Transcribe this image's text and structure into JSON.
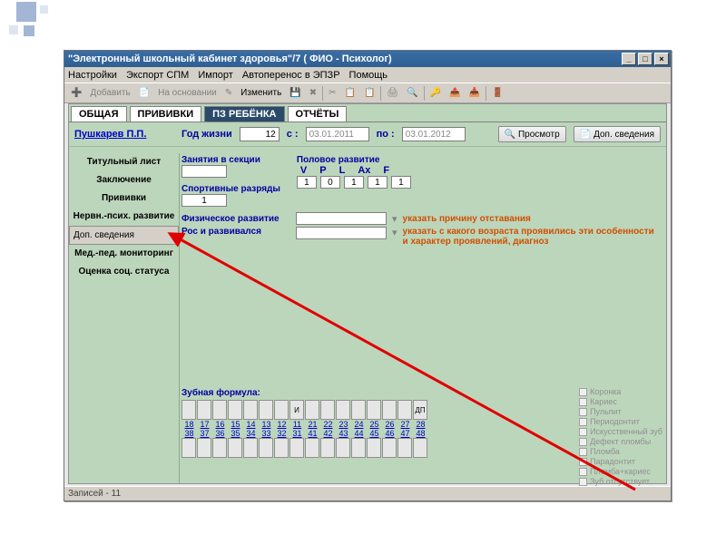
{
  "window": {
    "title": "\"Электронный школьный кабинет здоровья\"/7 ( ФИО - Психолог)"
  },
  "menu": {
    "settings": "Настройки",
    "export": "Экспорт СПМ",
    "import": "Импорт",
    "autotransfer": "Автоперенос в ЭПЗР",
    "help": "Помощь"
  },
  "toolbar": {
    "add": "Добавить",
    "based": "На основании",
    "edit": "Изменить"
  },
  "tabs": {
    "general": "ОБЩАЯ",
    "vaccines": "ПРИВИВКИ",
    "child": "ПЗ РЕБЁНКА",
    "reports": "ОТЧЁТЫ"
  },
  "header": {
    "name": "Пушкарев П.П.",
    "year_label": "Год жизни",
    "year_value": "12",
    "from_label": "с :",
    "from_date": "03.01.2011",
    "to_label": "по :",
    "to_date": "03.01.2012",
    "view_btn": "Просмотр",
    "extra_btn": "Доп. сведения"
  },
  "sidebar": {
    "items": [
      "Титульный лист",
      "Заключение",
      "Прививки",
      "Нервн.-псих. развитие",
      "Доп. сведения",
      "Мед.-пед. мониторинг",
      "Оценка соц. статуса"
    ]
  },
  "content": {
    "sections_label": "Занятия в секции",
    "sport_label": "Спортивные разряды",
    "sport_value": "1",
    "sex_label": "Половое развитие",
    "sex_cols": [
      "V",
      "P",
      "L",
      "Ax",
      "F"
    ],
    "sex_vals": [
      "1",
      "0",
      "1",
      "1",
      "1"
    ],
    "phys_label": "Физическое развитие",
    "phys_note": "указать причину отставания",
    "growth_label": "Рос и развивался",
    "growth_note": "указать с какого возраста проявились эти особенности и характер проявлений, диагноз",
    "dental_label": "Зубная формула:",
    "tooth_I": "И",
    "tooth_DP": "ДП",
    "top_nums": [
      "18",
      "17",
      "16",
      "15",
      "14",
      "13",
      "12",
      "11",
      "21",
      "22",
      "23",
      "24",
      "25",
      "26",
      "27",
      "28"
    ],
    "bot_nums": [
      "38",
      "37",
      "36",
      "35",
      "34",
      "33",
      "32",
      "31",
      "41",
      "42",
      "43",
      "44",
      "45",
      "46",
      "47",
      "48"
    ],
    "checks": [
      "Коронка",
      "Кариес",
      "Пульпит",
      "Периодонтит",
      "Искусственный зуб",
      "Дефект пломбы",
      "Пломба",
      "Парадонтит",
      "Пломба+кариес",
      "Зуб отсутствует"
    ]
  },
  "status": {
    "records": "Записей - 11"
  }
}
